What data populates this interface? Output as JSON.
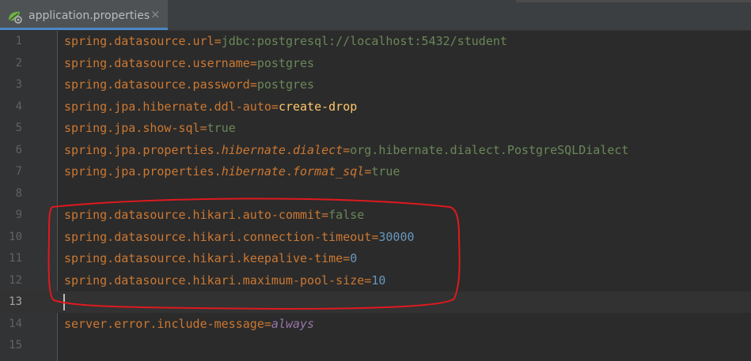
{
  "tab": {
    "filename": "application.properties",
    "close_glyph": "×",
    "icon": "spring-leaf-icon"
  },
  "colors": {
    "key": "#cc7832",
    "value": "#6a8759",
    "number": "#6897bb",
    "highlight_value": "#ffc66d",
    "italic_value": "#9876aa",
    "annotation": "#e0191e"
  },
  "lines": [
    {
      "n": "1",
      "parts": [
        [
          "k",
          "spring.datasource.url"
        ],
        [
          "e",
          "="
        ],
        [
          "v",
          "jdbc:postgresql://localhost:5432/student"
        ]
      ]
    },
    {
      "n": "2",
      "parts": [
        [
          "k",
          "spring.datasource.username"
        ],
        [
          "e",
          "="
        ],
        [
          "v",
          "postgres"
        ]
      ]
    },
    {
      "n": "3",
      "parts": [
        [
          "k",
          "spring.datasource.password"
        ],
        [
          "e",
          "="
        ],
        [
          "v",
          "postgres"
        ]
      ]
    },
    {
      "n": "4",
      "parts": [
        [
          "k",
          "spring.jpa.hibernate.ddl-auto"
        ],
        [
          "e",
          "="
        ],
        [
          "vy",
          "create-drop"
        ]
      ]
    },
    {
      "n": "5",
      "parts": [
        [
          "k",
          "spring.jpa.show-sql"
        ],
        [
          "e",
          "="
        ],
        [
          "v",
          "true"
        ]
      ]
    },
    {
      "n": "6",
      "parts": [
        [
          "k",
          "spring.jpa.properties."
        ],
        [
          "i",
          "hibernate"
        ],
        [
          "k",
          "."
        ],
        [
          "i",
          "dialect"
        ],
        [
          "e",
          "="
        ],
        [
          "v",
          "org.hibernate.dialect.PostgreSQLDialect"
        ]
      ]
    },
    {
      "n": "7",
      "parts": [
        [
          "k",
          "spring.jpa.properties."
        ],
        [
          "i",
          "hibernate"
        ],
        [
          "k",
          "."
        ],
        [
          "i",
          "format_sql"
        ],
        [
          "e",
          "="
        ],
        [
          "v",
          "true"
        ]
      ]
    },
    {
      "n": "8",
      "parts": []
    },
    {
      "n": "9",
      "parts": [
        [
          "k",
          "spring.datasource.hikari.auto-commit"
        ],
        [
          "e",
          "="
        ],
        [
          "v",
          "false"
        ]
      ]
    },
    {
      "n": "10",
      "parts": [
        [
          "k",
          "spring.datasource.hikari.connection-timeout"
        ],
        [
          "e",
          "="
        ],
        [
          "n",
          "30000"
        ]
      ]
    },
    {
      "n": "11",
      "parts": [
        [
          "k",
          "spring.datasource.hikari.keepalive-time"
        ],
        [
          "e",
          "="
        ],
        [
          "n",
          "0"
        ]
      ]
    },
    {
      "n": "12",
      "parts": [
        [
          "k",
          "spring.datasource.hikari.maximum-pool-size"
        ],
        [
          "e",
          "="
        ],
        [
          "n",
          "10"
        ]
      ]
    },
    {
      "n": "13",
      "parts": [],
      "current": true
    },
    {
      "n": "14",
      "parts": [
        [
          "k",
          "server.error.include-message"
        ],
        [
          "e",
          "="
        ],
        [
          "vi",
          "always"
        ]
      ]
    },
    {
      "n": "15",
      "parts": []
    }
  ]
}
